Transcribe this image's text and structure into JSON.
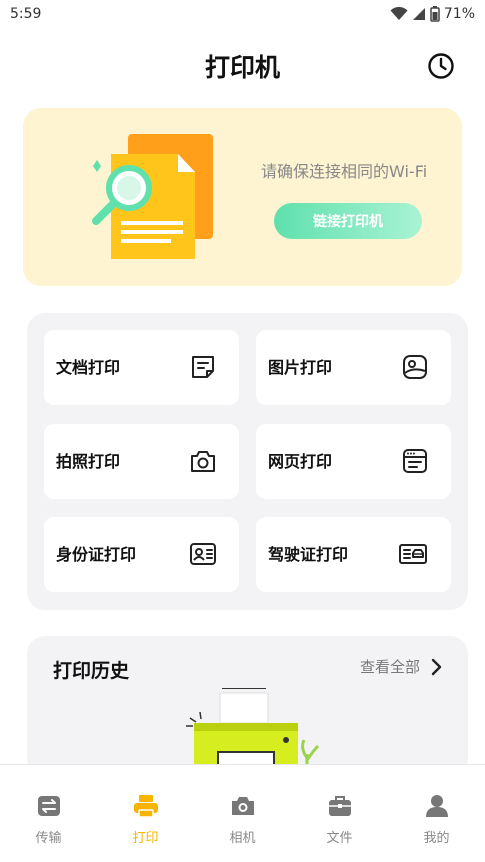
{
  "status_bar": {
    "time": "5:59",
    "battery": "71%"
  },
  "header": {
    "title": "打印机"
  },
  "banner": {
    "hint": "请确保连接相同的Wi-Fi",
    "connect_label": "链接打印机"
  },
  "grid": {
    "items": [
      {
        "label": "文档打印",
        "icon": "document-icon"
      },
      {
        "label": "图片打印",
        "icon": "image-icon"
      },
      {
        "label": "拍照打印",
        "icon": "camera-icon"
      },
      {
        "label": "网页打印",
        "icon": "webpage-icon"
      },
      {
        "label": "身份证打印",
        "icon": "id-card-icon"
      },
      {
        "label": "驾驶证打印",
        "icon": "driver-license-icon"
      }
    ]
  },
  "history": {
    "title": "打印历史",
    "view_all": "查看全部"
  },
  "bottom_nav": {
    "items": [
      {
        "label": "传输",
        "icon": "transfer-icon",
        "active": false
      },
      {
        "label": "打印",
        "icon": "printer-icon",
        "active": true
      },
      {
        "label": "相机",
        "icon": "camera-icon",
        "active": false
      },
      {
        "label": "文件",
        "icon": "briefcase-icon",
        "active": false
      },
      {
        "label": "我的",
        "icon": "user-icon",
        "active": false
      }
    ]
  },
  "colors": {
    "accent": "#f7b500",
    "banner_bg": "#fef4d2",
    "button_green": "#5fe0ad",
    "panel_bg": "#f3f3f5"
  }
}
